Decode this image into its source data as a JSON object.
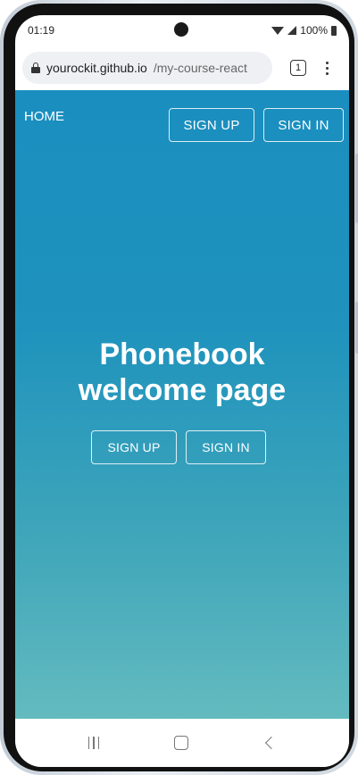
{
  "status_bar": {
    "time": "01:19",
    "battery": "100%"
  },
  "browser": {
    "url_host": "yourockit.github.io",
    "url_path": "/my-course-react",
    "tab_count": "1"
  },
  "site_nav": {
    "home_label": "HOME",
    "signup_label": "SIGN UP",
    "signin_label": "SIGN IN"
  },
  "hero": {
    "title_line1": "Phonebook",
    "title_line2": "welcome page",
    "signup_label": "SIGN UP",
    "signin_label": "SIGN IN"
  },
  "colors": {
    "gradient_top": "#1a8ebf",
    "gradient_bottom": "#63bbbf"
  },
  "icons": [
    "lock-icon",
    "wifi-icon",
    "signal-icon",
    "battery-icon",
    "tabs-icon",
    "menu-icon",
    "recents-icon",
    "home-icon",
    "back-icon"
  ]
}
